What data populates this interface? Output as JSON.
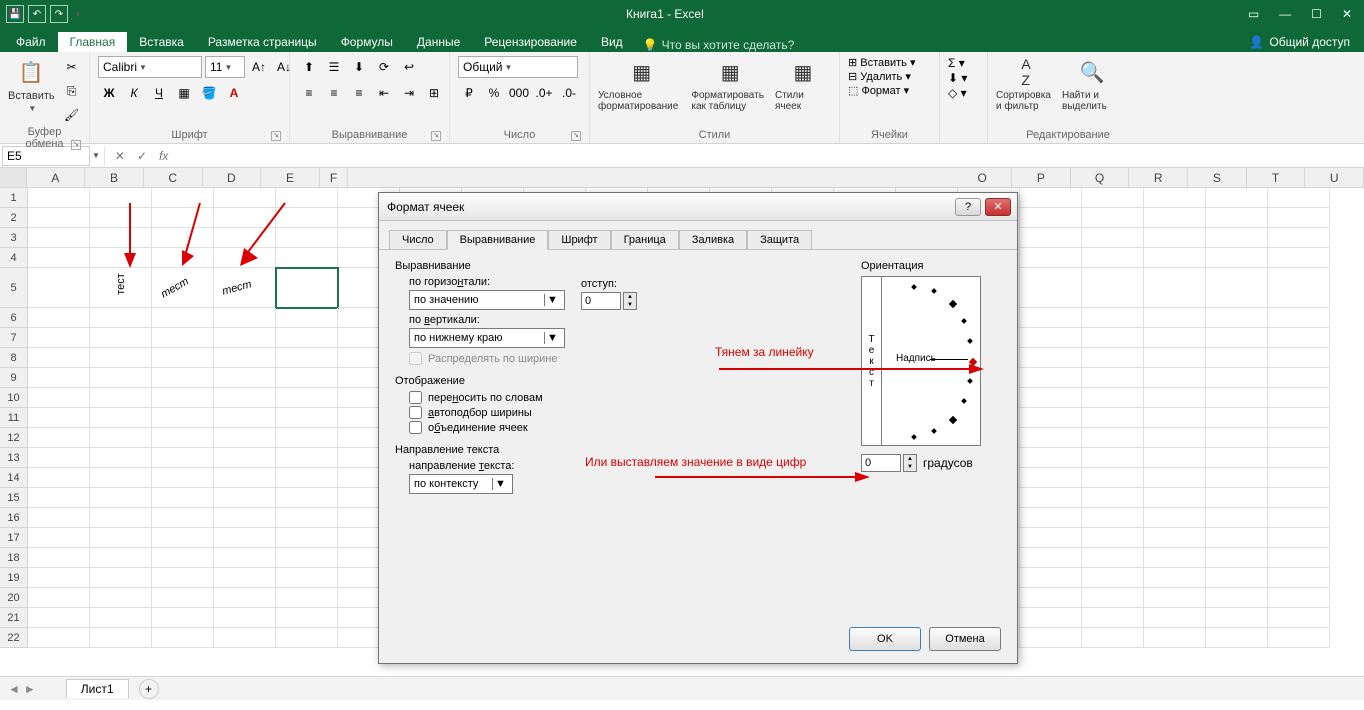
{
  "title": "Книга1 - Excel",
  "tabs": {
    "file": "Файл",
    "home": "Главная",
    "insert": "Вставка",
    "layout": "Разметка страницы",
    "formulas": "Формулы",
    "data": "Данные",
    "review": "Рецензирование",
    "view": "Вид",
    "tell": "Что вы хотите сделать?",
    "share": "Общий доступ"
  },
  "ribbon": {
    "paste": "Вставить",
    "clipboard": "Буфер обмена",
    "font_name": "Calibri",
    "font_size": "11",
    "font": "Шрифт",
    "alignment": "Выравнивание",
    "number_format": "Общий",
    "number": "Число",
    "conditional": "Условное форматирование",
    "format_table": "Форматировать как таблицу",
    "cell_styles": "Стили ячеек",
    "styles": "Стили",
    "insert_btn": "Вставить",
    "delete_btn": "Удалить",
    "format_btn": "Формат",
    "cells": "Ячейки",
    "sort": "Сортировка и фильтр",
    "find": "Найти и выделить",
    "editing": "Редактирование"
  },
  "namebox": "E5",
  "cols": [
    "A",
    "B",
    "C",
    "D",
    "E",
    "F",
    "",
    "",
    "",
    "",
    "",
    "",
    "O",
    "P",
    "Q",
    "R",
    "S",
    "T",
    "U"
  ],
  "rows": [
    "1",
    "2",
    "3",
    "4",
    "5",
    "6",
    "7",
    "8",
    "9",
    "10",
    "11",
    "12",
    "13",
    "14",
    "15",
    "16",
    "17",
    "18",
    "19",
    "20",
    "21",
    "22"
  ],
  "celltext": "тест",
  "sheet": "Лист1",
  "dialog": {
    "title": "Формат ячеек",
    "tabs": {
      "number": "Число",
      "alignment": "Выравнивание",
      "font": "Шрифт",
      "border": "Граница",
      "fill": "Заливка",
      "protection": "Защита"
    },
    "sect_align": "Выравнивание",
    "h_label": "по горизонтали:",
    "h_value": "по значению",
    "indent_label": "отступ:",
    "indent_value": "0",
    "v_label": "по вертикали:",
    "v_value": "по нижнему краю",
    "distribute": "Распределять по ширине",
    "sect_display": "Отображение",
    "wrap": "переносить по словам",
    "shrink": "автоподбор ширины",
    "merge": "объединение ячеек",
    "sect_dir": "Направление текста",
    "dir_label": "направление текста:",
    "dir_value": "по контексту",
    "sect_orient": "Ориентация",
    "orient_text": "Текст",
    "orient_label": "Надпись",
    "degrees_value": "0",
    "degrees_label": "градусов",
    "ok": "OK",
    "cancel": "Отмена"
  },
  "annotations": {
    "pull": "Тянем за линейку",
    "or_set": "Или выставляем значение в виде цифр"
  }
}
